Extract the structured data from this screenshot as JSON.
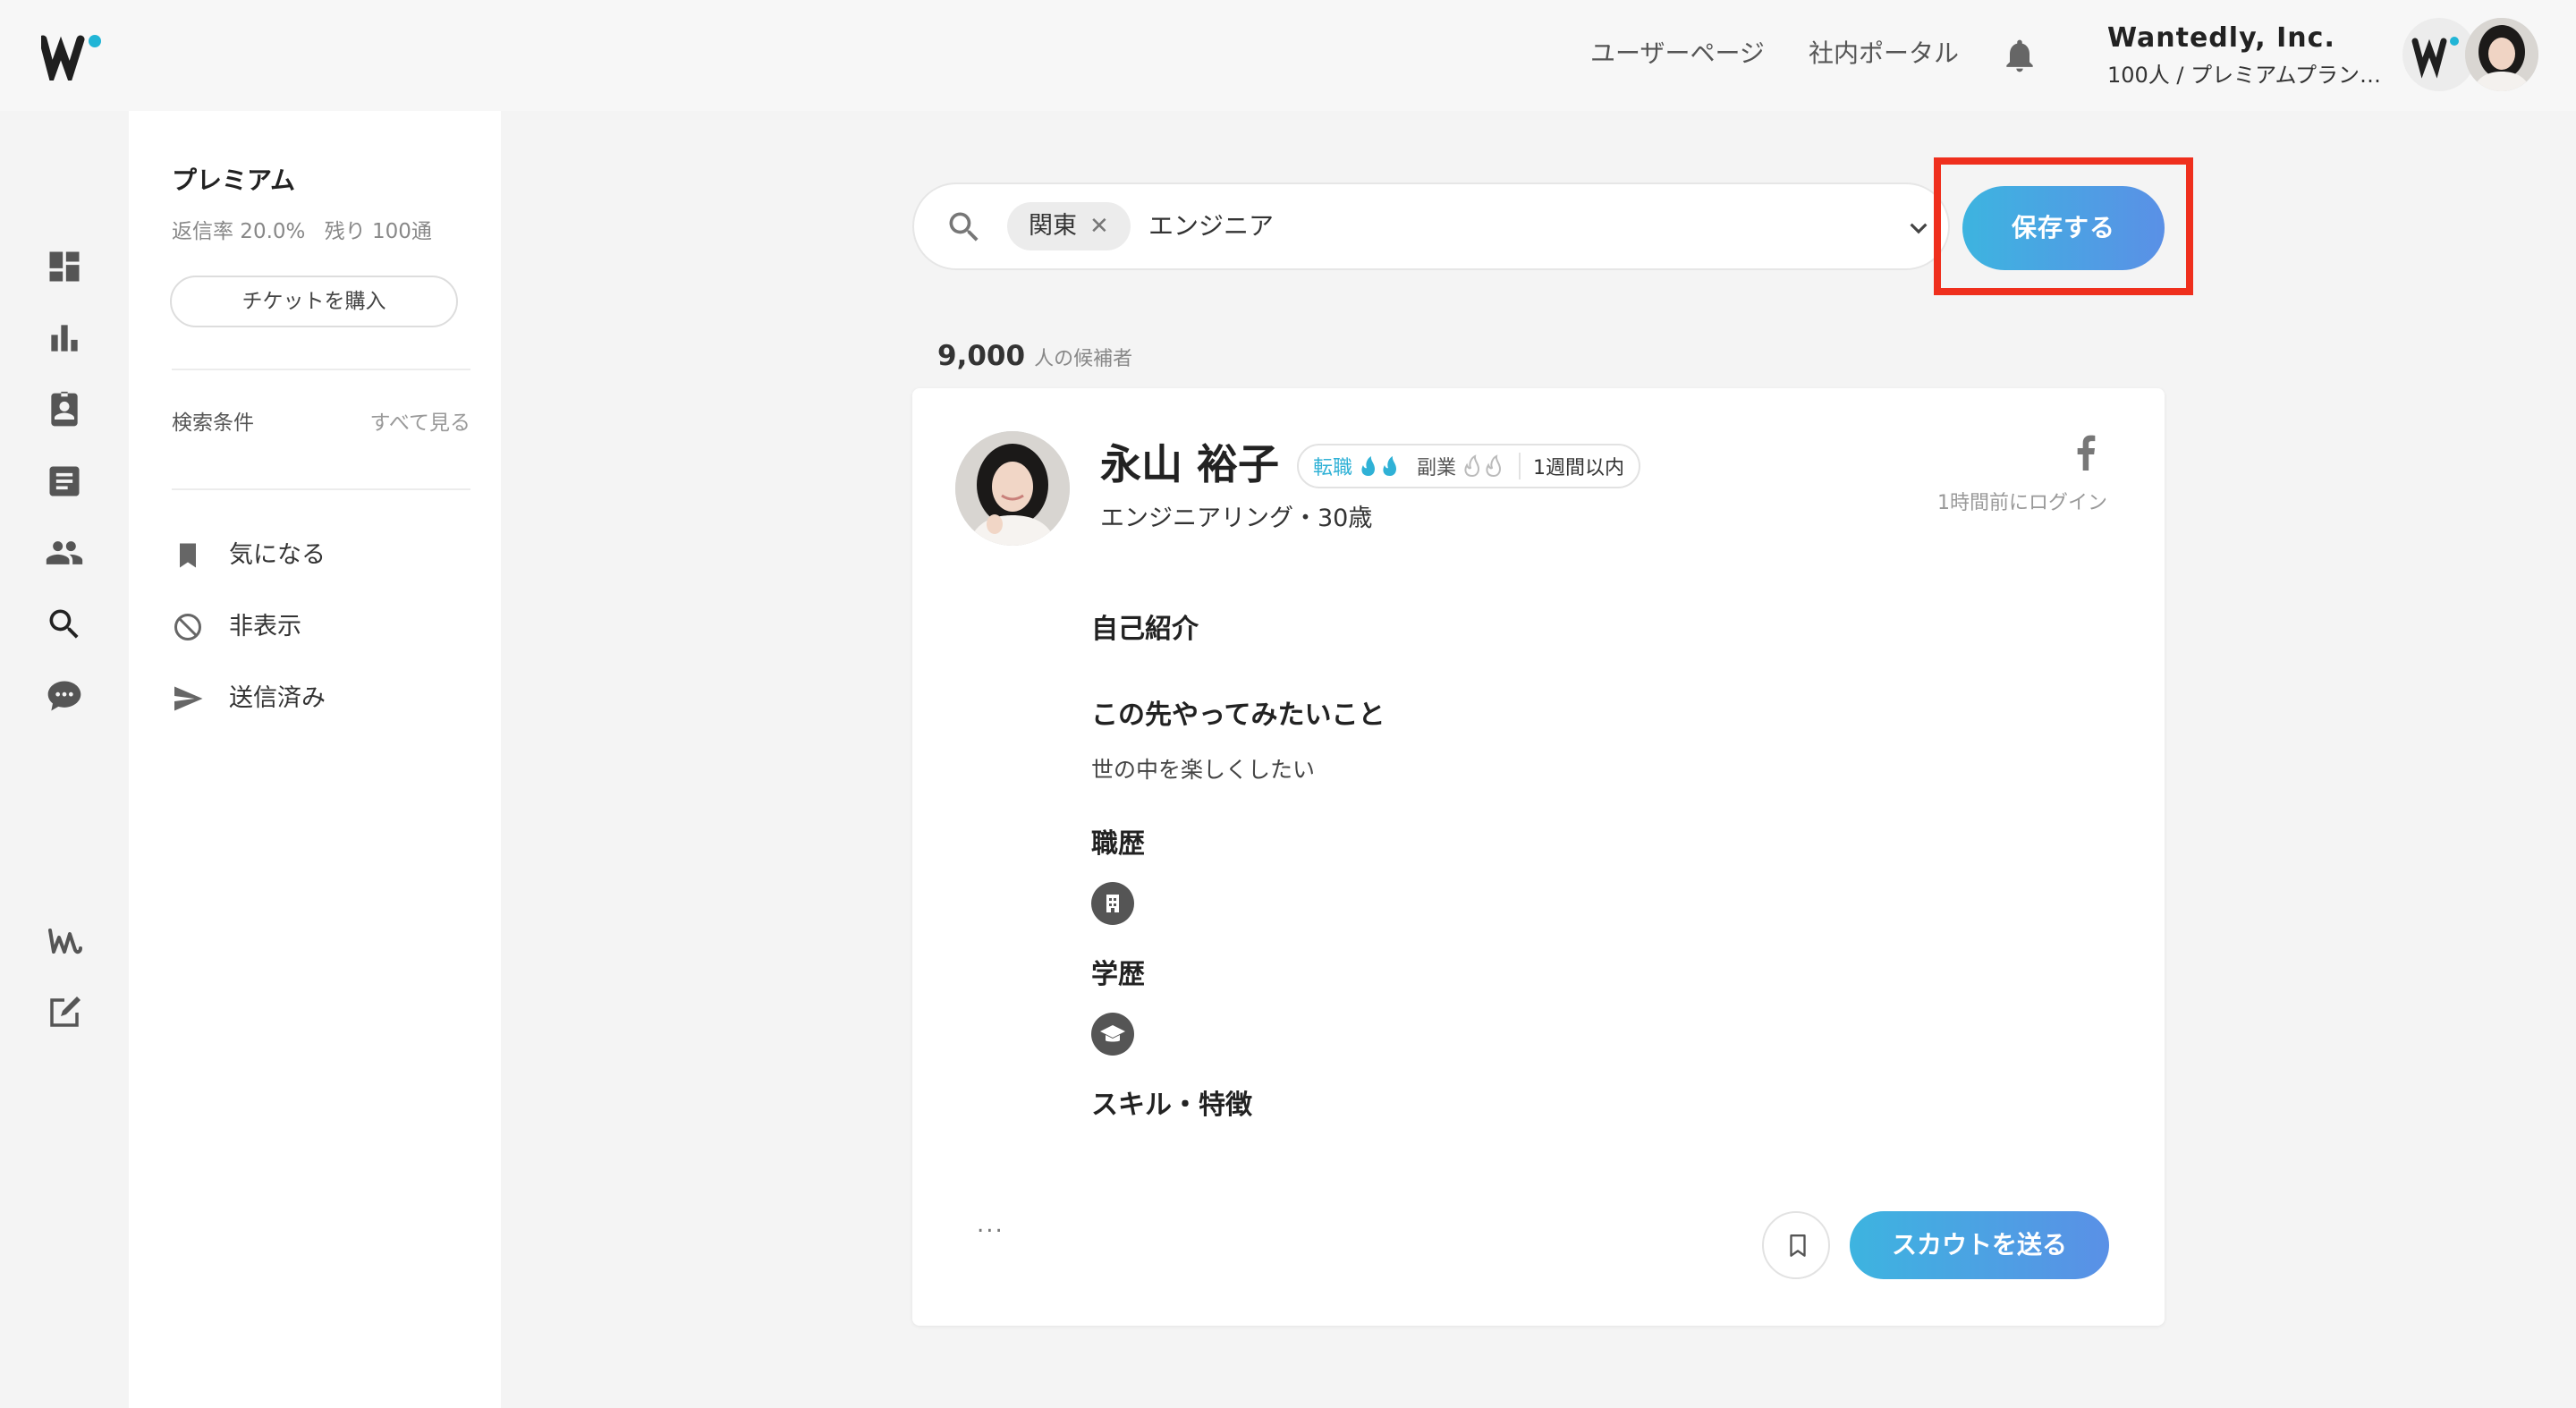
{
  "header": {
    "logo_icon": "wantedly-w-logo",
    "nav": [
      {
        "label": "ユーザーページ"
      },
      {
        "label": "社内ポータル"
      }
    ],
    "bell_icon": "bell-icon",
    "company_name": "Wantedly, Inc.",
    "company_plan": "100人 / プレミアムプラン ...",
    "accent_color": "#21b5d6"
  },
  "rail": {
    "icons": [
      "dashboard-icon",
      "bar-chart-icon",
      "badge-icon",
      "list-icon",
      "people-icon",
      "search-icon",
      "chat-icon",
      "wantedly-w-icon",
      "edit-icon"
    ]
  },
  "sidebar": {
    "title": "プレミアム",
    "reply_rate": "返信率 20.0%",
    "remaining": "残り 100通",
    "ticket_button": "チケットを購入",
    "conditions_label": "検索条件",
    "see_all": "すべて見る",
    "items": [
      {
        "label": "気になる",
        "icon": "bookmark-icon"
      },
      {
        "label": "非表示",
        "icon": "block-icon"
      },
      {
        "label": "送信済み",
        "icon": "send-icon"
      }
    ]
  },
  "search": {
    "chip": "関東",
    "query": "エンジニア",
    "save_button": "保存する",
    "highlight_color": "#ef2f1d"
  },
  "results": {
    "count": "9,000",
    "count_label": "人の候補者"
  },
  "candidate": {
    "name": "永山 裕子",
    "tag_job_change": "転職",
    "tag_side_job": "副業",
    "tag_recency": "1週間以内",
    "subtitle": "エンジニアリング・30歳",
    "last_login": "1時間前にログイン",
    "social_icon": "facebook-icon",
    "sections": {
      "intro": "自己紹介",
      "future_heading": "この先やってみたいこと",
      "future_text": "世の中を楽しくしたい",
      "career": "職歴",
      "education": "学歴",
      "skills": "スキル・特徴"
    },
    "more_label": "...",
    "scout_button": "スカウトを送る"
  }
}
